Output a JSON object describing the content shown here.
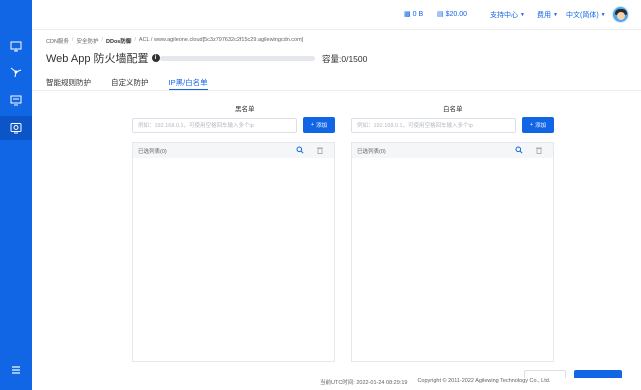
{
  "topbar": {
    "traffic": "0 B",
    "balance": "$20.00",
    "support": "支持中心",
    "billing": "费用",
    "language": "中文(简体)"
  },
  "breadcrumb": {
    "items": [
      "CDN服务",
      "安全防护",
      "DDos防御",
      "ACL / www.agileone.cloud[5c3z797632c2f15c29.agilewingcdn.com]"
    ],
    "separator": "/"
  },
  "page": {
    "title": "Web App 防火墙配置",
    "capacity": "容量:0/1500",
    "capacity_fraction": 0.0
  },
  "tabs": [
    "智能规则防护",
    "自定义防护",
    "IP黑/白名单"
  ],
  "active_tab_index": 2,
  "blacklist": {
    "heading": "黑名单",
    "placeholder": "例如：192.168.0.1，可使用空格回车输入多个ip",
    "add_label": "添加",
    "selected_label": "已选列表(0)"
  },
  "whitelist": {
    "heading": "白名单",
    "placeholder": "例如：192.168.0.1，可使用空格回车输入多个ip",
    "add_label": "添加",
    "selected_label": "已选列表(0)"
  },
  "footer": {
    "utc_time": "当前UTC时间: 2022-01-24 08:29:19",
    "copyright": "Copyright © 2011-2022 Agilewing Technology Co., Ltd."
  },
  "colors": {
    "primary": "#1166e6",
    "sidebar": "#1166e6"
  },
  "icons": {
    "sidebar": [
      "monitor-icon",
      "network-icon",
      "monitor-icon",
      "shield-screen-icon",
      "menu-icon"
    ],
    "list": [
      "search-icon",
      "trash-icon"
    ],
    "topbar": [
      "bar-chart-icon",
      "wallet-icon",
      "chevron-down-icon",
      "user-avatar"
    ]
  }
}
